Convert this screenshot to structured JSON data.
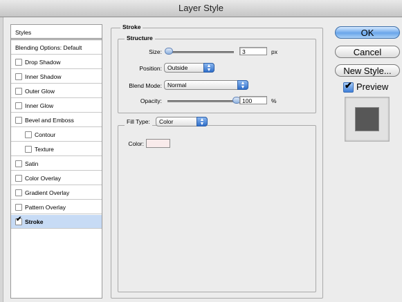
{
  "window": {
    "title": "Layer Style"
  },
  "styles_panel": {
    "header": "Styles",
    "blending": "Blending Options: Default",
    "items": [
      {
        "label": "Drop Shadow",
        "checked": false
      },
      {
        "label": "Inner Shadow",
        "checked": false
      },
      {
        "label": "Outer Glow",
        "checked": false
      },
      {
        "label": "Inner Glow",
        "checked": false
      },
      {
        "label": "Bevel and Emboss",
        "checked": false
      },
      {
        "label": "Contour",
        "checked": false
      },
      {
        "label": "Texture",
        "checked": false
      },
      {
        "label": "Satin",
        "checked": false
      },
      {
        "label": "Color Overlay",
        "checked": false
      },
      {
        "label": "Gradient Overlay",
        "checked": false
      },
      {
        "label": "Pattern Overlay",
        "checked": false
      },
      {
        "label": "Stroke",
        "checked": true
      }
    ]
  },
  "stroke": {
    "title": "Stroke",
    "structure": {
      "title": "Structure",
      "size_label": "Size:",
      "size_value": "3",
      "size_unit": "px",
      "position_label": "Position:",
      "position_value": "Outside",
      "blend_label": "Blend Mode:",
      "blend_value": "Normal",
      "opacity_label": "Opacity:",
      "opacity_value": "100",
      "opacity_unit": "%"
    },
    "fill": {
      "type_label": "Fill Type:",
      "type_value": "Color",
      "color_label": "Color:",
      "color_value": "#f9ebeb"
    }
  },
  "buttons": {
    "ok": "OK",
    "cancel": "Cancel",
    "new_style": "New Style...",
    "preview_label": "Preview"
  }
}
